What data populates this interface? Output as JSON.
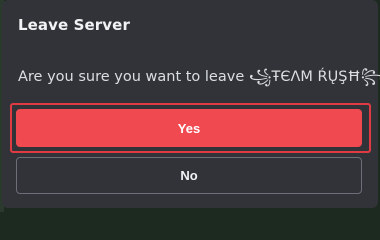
{
  "dialog": {
    "title": "Leave Server",
    "message_prefix": "Are you sure you want to leave ",
    "server_name": "꧁ŦЄΛM ŔŲŞĦ꧂",
    "message_suffix": "?",
    "yes_label": "Yes",
    "no_label": "No"
  },
  "colors": {
    "modal_background": "#313338",
    "danger": "#f04a50",
    "focus_ring": "#e03b43",
    "outline_border": "#6d6f78"
  }
}
